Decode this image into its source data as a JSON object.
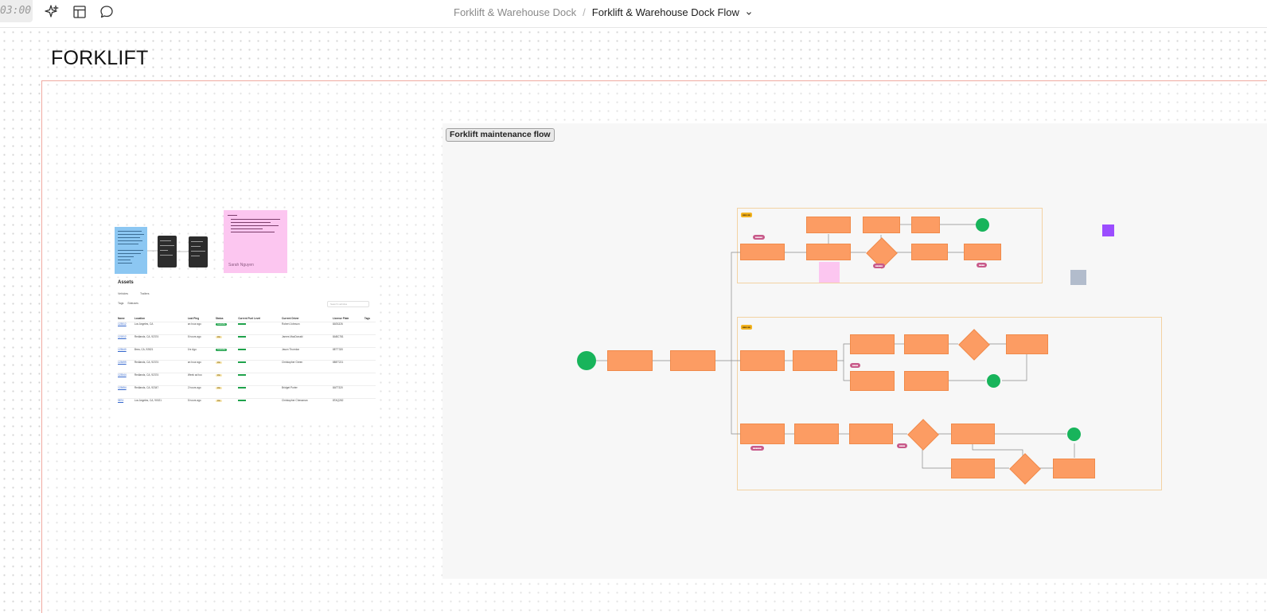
{
  "toolbar": {
    "clock": "03:00",
    "icons": [
      "sparkle-icon",
      "layout-icon",
      "comment-icon"
    ]
  },
  "breadcrumb": {
    "parent": "Forklift & Warehouse Dock",
    "separator": "/",
    "current": "Forklift & Warehouse Dock Flow"
  },
  "canvas": {
    "section_title": "FORKLIFT",
    "flow_label": "Forklift maintenance flow"
  },
  "pink_note": {
    "signature": "Sarah Nguyen"
  },
  "assets_table": {
    "title": "Assets",
    "tabs": [
      "Vehicles",
      "Trailers"
    ],
    "filters": [
      "Tags",
      "Statuses"
    ],
    "search_placeholder": "Search vehicles",
    "columns": [
      "Name",
      "Location",
      "Last Ping",
      "Status",
      "Current Fuel Level",
      "Current Driver",
      "License Plate",
      "Tags"
    ],
    "rows": [
      {
        "name": "123512",
        "location": "Los Angeles, CA",
        "ping": "an hour ago",
        "status": "Available",
        "driver": "Robert Johnson",
        "plate": "8ATA326"
      },
      {
        "name": "121512",
        "location": "Redlands, CA, 92374",
        "ping": "5 hours ago",
        "status": "Idle",
        "driver": "James MacDonald",
        "plate": "8ABC781"
      },
      {
        "name": "123640",
        "location": "Brea, CA, 92821",
        "ping": "1hr Ago",
        "status": "Available",
        "driver": "Jason Thornton",
        "plate": "8ETT320"
      },
      {
        "name": "123699",
        "location": "Redlands, CA, 92374",
        "ping": "an hour ago",
        "status": "Idle",
        "driver": "Christopher Green",
        "plate": "8BET221"
      },
      {
        "name": "123544",
        "location": "Redlands, CA, 92374",
        "ping": "Week ad too",
        "status": "Idle",
        "driver": "",
        "plate": ""
      },
      {
        "name": "123654",
        "location": "Redlands, CA, 92347",
        "ping": "2 hours ago",
        "status": "Idle",
        "driver": "Bridget Porter",
        "plate": "8ATT320"
      },
      {
        "name": "9874",
        "location": "Los Angeles, CA, 90021",
        "ping": "5 hours ago",
        "status": "Idle",
        "driver": "Christopher Chessman",
        "plate": "8TAQ282"
      }
    ]
  },
  "colors": {
    "process": "#fc9c63",
    "terminal": "#18b45b",
    "tag": "#c85a8a",
    "frame_border": "#f0a9a0"
  }
}
